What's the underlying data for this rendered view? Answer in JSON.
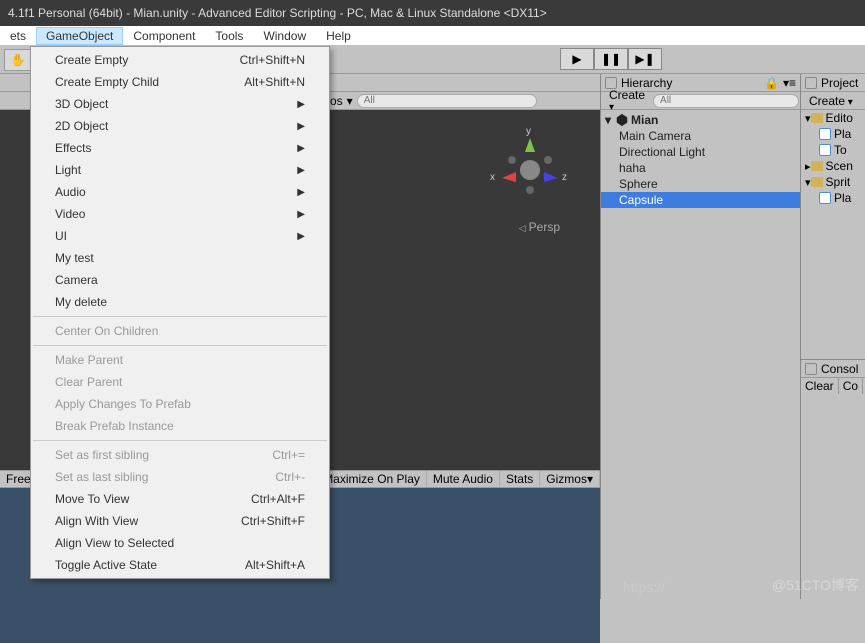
{
  "window": {
    "title": "4.1f1 Personal (64bit) - Mian.unity - Advanced Editor Scripting - PC, Mac & Linux Standalone <DX11>"
  },
  "menubar": {
    "items": [
      "ets",
      "GameObject",
      "Component",
      "Tools",
      "Window",
      "Help"
    ],
    "active_index": 1
  },
  "dropdown": {
    "items": [
      {
        "label": "Create Empty",
        "shortcut": "Ctrl+Shift+N"
      },
      {
        "label": "Create Empty Child",
        "shortcut": "Alt+Shift+N"
      },
      {
        "label": "3D Object",
        "submenu": true
      },
      {
        "label": "2D Object",
        "submenu": true
      },
      {
        "label": "Effects",
        "submenu": true
      },
      {
        "label": "Light",
        "submenu": true
      },
      {
        "label": "Audio",
        "submenu": true
      },
      {
        "label": "Video",
        "submenu": true
      },
      {
        "label": "UI",
        "submenu": true
      },
      {
        "label": "My test"
      },
      {
        "label": "Camera"
      },
      {
        "label": "My delete"
      },
      {
        "sep": true
      },
      {
        "label": "Center On Children",
        "disabled": true
      },
      {
        "sep": true
      },
      {
        "label": "Make Parent",
        "disabled": true
      },
      {
        "label": "Clear Parent",
        "disabled": true
      },
      {
        "label": "Apply Changes To Prefab",
        "disabled": true
      },
      {
        "label": "Break Prefab Instance",
        "disabled": true
      },
      {
        "sep": true
      },
      {
        "label": "Set as first sibling",
        "shortcut": "Ctrl+=",
        "disabled": true
      },
      {
        "label": "Set as last sibling",
        "shortcut": "Ctrl+-",
        "disabled": true
      },
      {
        "label": "Move To View",
        "shortcut": "Ctrl+Alt+F"
      },
      {
        "label": "Align With View",
        "shortcut": "Ctrl+Shift+F"
      },
      {
        "label": "Align View to Selected"
      },
      {
        "label": "Toggle Active State",
        "shortcut": "Alt+Shift+A"
      }
    ]
  },
  "scene": {
    "gizmos_label": "zmos",
    "search_placeholder": "All",
    "persp": "Persp",
    "axes": {
      "x": "x",
      "y": "y",
      "z": "z"
    }
  },
  "gamebar": {
    "free": "Free",
    "maximize": "Maximize On Play",
    "mute": "Mute Audio",
    "stats": "Stats",
    "gizmos": "Gizmos"
  },
  "hierarchy": {
    "title": "Hierarchy",
    "create": "Create",
    "search_placeholder": "All",
    "scene_name": "Mian",
    "items": [
      "Main Camera",
      "Directional Light",
      "haha",
      "Sphere",
      "Capsule"
    ],
    "selected_index": 4
  },
  "project": {
    "title": "Project",
    "create": "Create",
    "items": [
      {
        "type": "folder",
        "label": "Edito",
        "expanded": true
      },
      {
        "type": "script",
        "label": "Pla",
        "indent": 1
      },
      {
        "type": "script",
        "label": "To",
        "indent": 1
      },
      {
        "type": "folder",
        "label": "Scen"
      },
      {
        "type": "folder",
        "label": "Sprit",
        "expanded": true
      },
      {
        "type": "script",
        "label": "Pla",
        "indent": 1
      }
    ]
  },
  "console": {
    "title": "Consol",
    "clear": "Clear",
    "collapse": "Co"
  },
  "watermark": "@51CTO博客",
  "watermark2": "https://"
}
